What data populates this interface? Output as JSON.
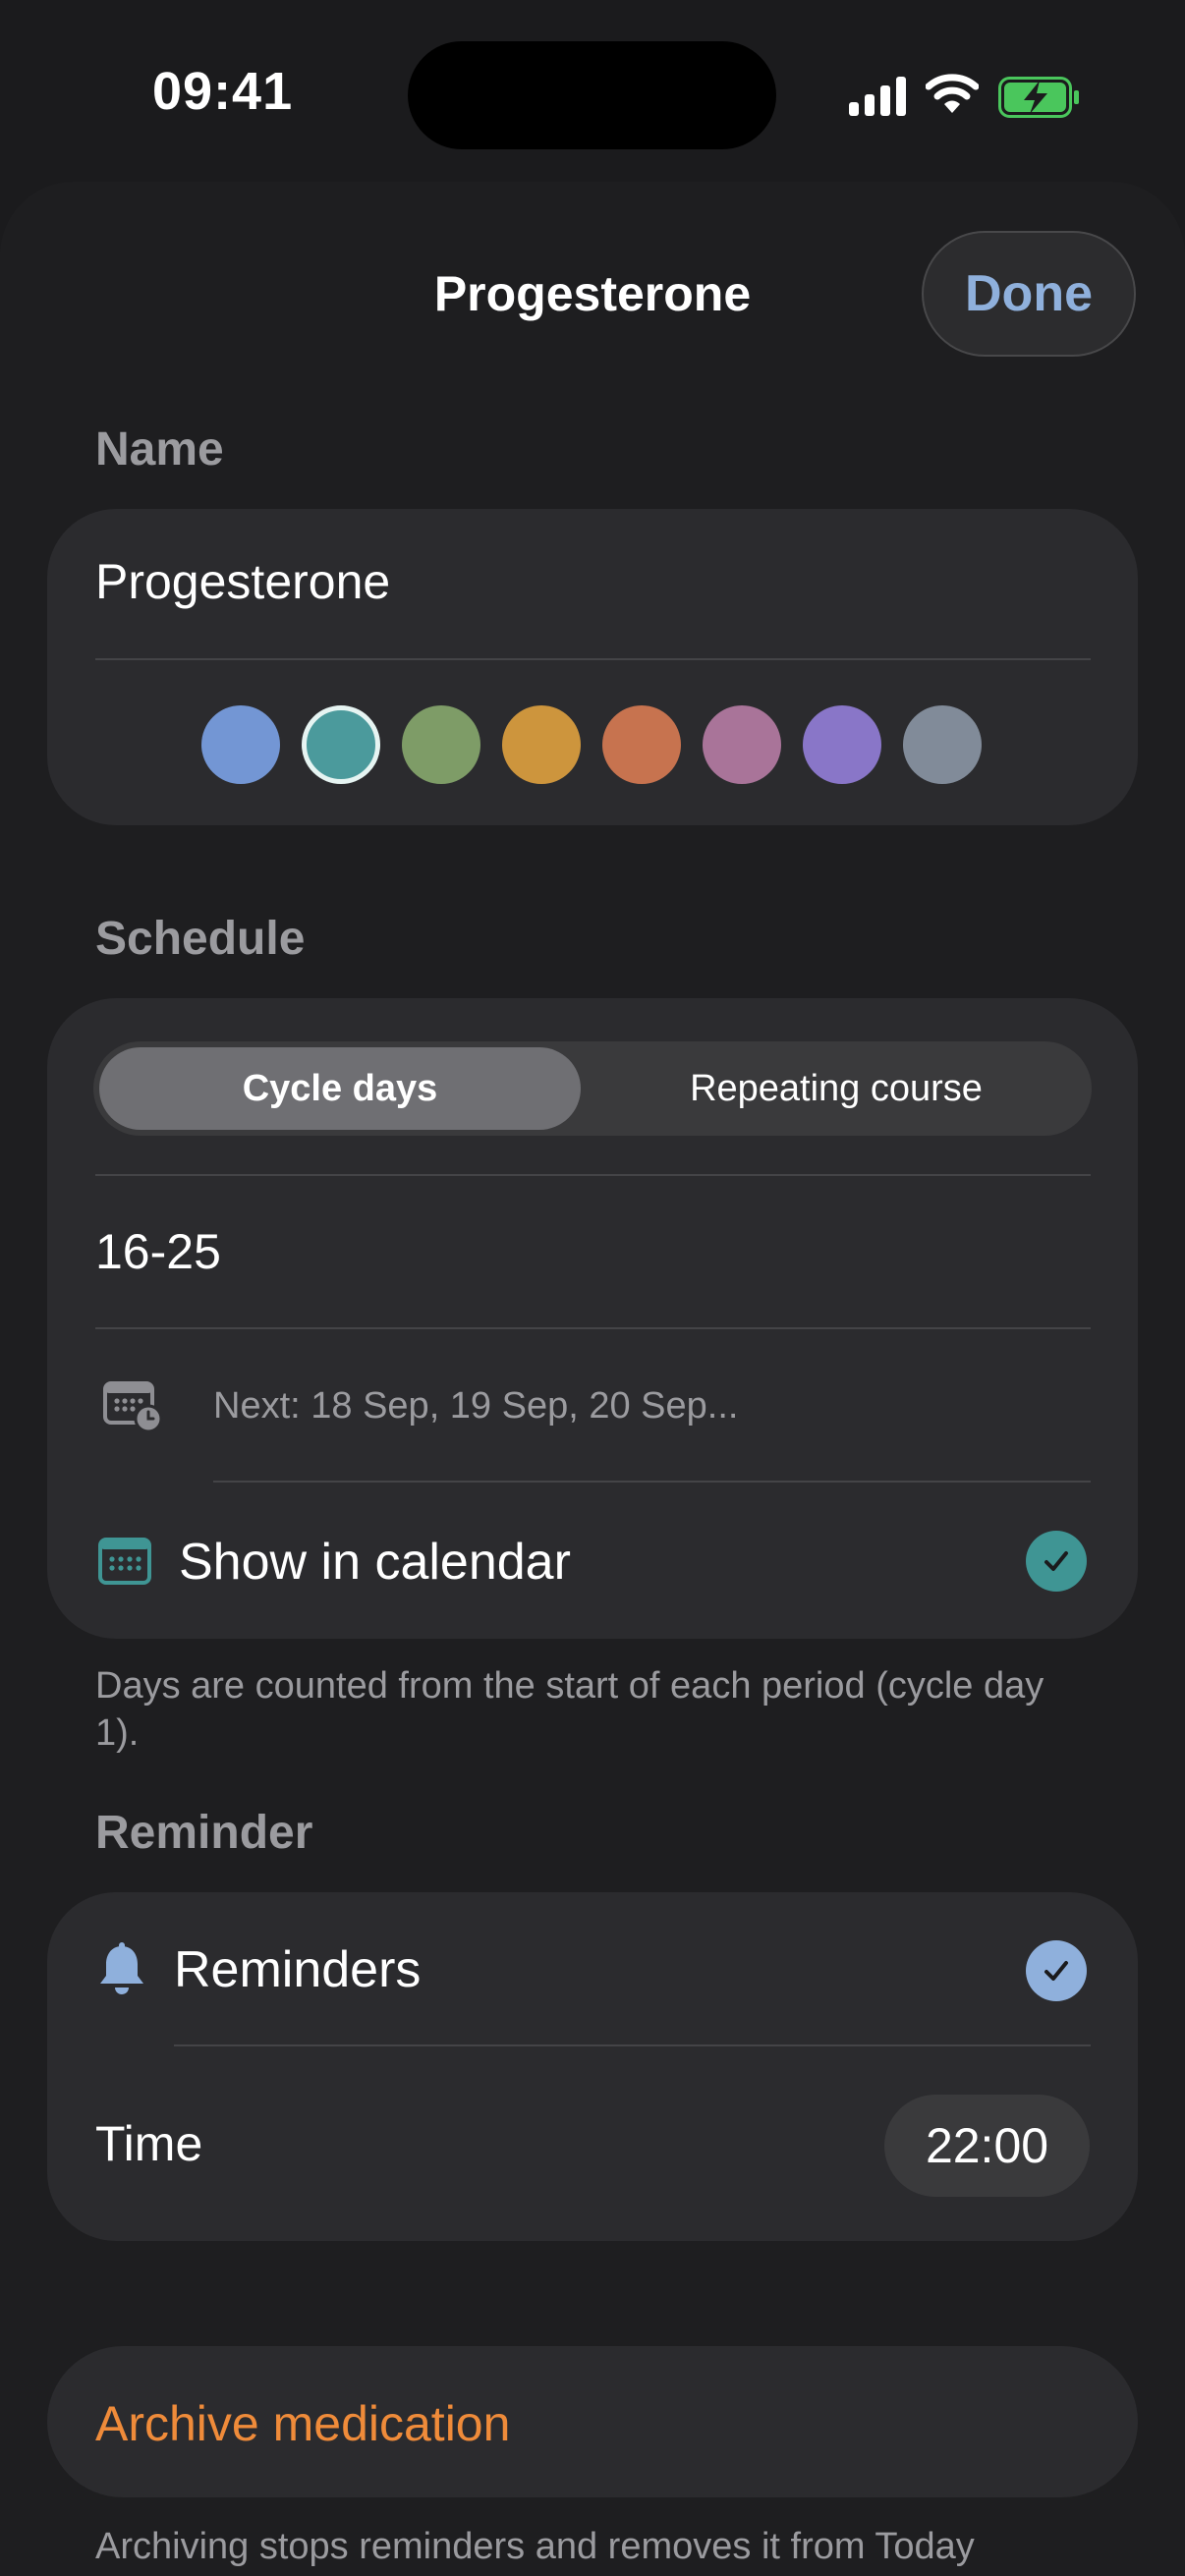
{
  "status_bar": {
    "time": "09:41"
  },
  "header": {
    "title": "Progesterone",
    "done_label": "Done"
  },
  "name_section": {
    "label": "Name",
    "value": "Progesterone",
    "colors": [
      "#7396d4",
      "#4b9a9c",
      "#7e9c67",
      "#cd953d",
      "#c7734f",
      "#a97499",
      "#8976c8",
      "#818b99"
    ],
    "selected_color_index": 1
  },
  "schedule_section": {
    "label": "Schedule",
    "tabs": [
      "Cycle days",
      "Repeating course"
    ],
    "active_tab": "Cycle days",
    "days_value": "16-25",
    "next_text": "Next: 18 Sep, 19 Sep, 20 Sep...",
    "show_in_calendar_label": "Show in calendar",
    "show_in_calendar_checked": true,
    "footnote": "Days are counted from the start of each period (cycle day 1)."
  },
  "reminder_section": {
    "label": "Reminder",
    "reminders_label": "Reminders",
    "reminders_checked": true,
    "time_label": "Time",
    "time_value": "22:00"
  },
  "archive": {
    "button_label": "Archive medication",
    "footnote": "Archiving stops reminders and removes it from Today"
  },
  "colors": {
    "accent_blue": "#8fb0dc",
    "accent_teal": "#3f9594",
    "archive_orange": "#ef8b3a"
  }
}
